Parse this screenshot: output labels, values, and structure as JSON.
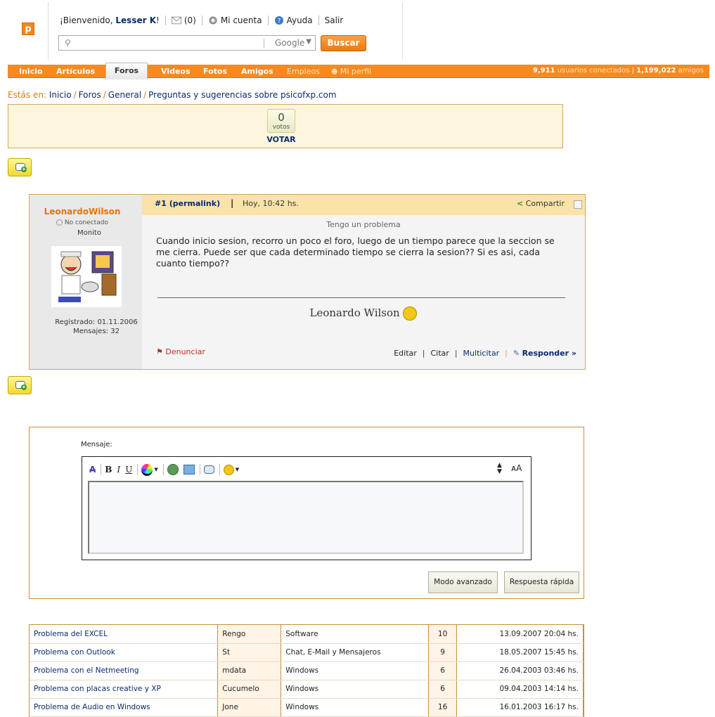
{
  "header": {
    "logo_letter": "p",
    "greeting": "¡Bienvenido,",
    "username": "Lesser K",
    "greeting_end": "!",
    "messages": "(0)",
    "account": "Mi cuenta",
    "help": "Ayuda",
    "logout": "Salir",
    "search_placeholder": "",
    "search_engine": "Google",
    "search_button": "Buscar"
  },
  "nav": {
    "items": [
      "Inicio",
      "Artículos",
      "Foros",
      "Videos",
      "Fotos",
      "Amigos",
      "Empleos",
      "Mi perfil"
    ],
    "users_online_count": "9,911",
    "users_online_label": "usuarios conectados",
    "friends_count": "1,199,022",
    "friends_label": "amigos"
  },
  "breadcrumb": {
    "prefix": "Estás en:",
    "items": [
      "Inicio",
      "Foros",
      "General",
      "Preguntas y sugerencias sobre psicofxp.com"
    ]
  },
  "vote": {
    "count": "0",
    "unit": "votos",
    "action": "VOTAR"
  },
  "post": {
    "author": "LeonardoWilson",
    "status": "No conectado",
    "rank": "Monito",
    "registered": "Registrado: 01.11.2006",
    "messages": "Mensajes: 32",
    "number": "#1",
    "permalink": "permalink",
    "date": "Hoy, 10:42 hs.",
    "share": "Compartir",
    "subject": "Tengo un problema",
    "text": "Cuando inicio sesion, recorro un poco el foro, luego de un tiempo parece que la seccion se me cierra. Puede ser que cada determinado tiempo se cierra la sesion?? Si es asi, cada cuanto tiempo??",
    "signature": "Leonardo Wilson",
    "report": "Denunciar",
    "edit": "Editar",
    "quote": "Citar",
    "multiquote": "Multicitar",
    "reply": "Responder »"
  },
  "reply_form": {
    "label": "Mensaje:",
    "advanced_button": "Modo avanzado",
    "quick_reply_button": "Respuesta rápida"
  },
  "related_threads": [
    {
      "title": "Problema del EXCEL",
      "author": "Rengo",
      "forum": "Software",
      "replies": "10",
      "date": "13.09.2007 20:04 hs."
    },
    {
      "title": "Problema con Outlook",
      "author": "St",
      "forum": "Chat, E-Mail y Mensajeros",
      "replies": "9",
      "date": "18.05.2007 15:45 hs."
    },
    {
      "title": "Problema con el Netmeeting",
      "author": "mdata",
      "forum": "Windows",
      "replies": "6",
      "date": "26.04.2003 03:46 hs."
    },
    {
      "title": "Problema con placas creative y XP",
      "author": "Cucumelo",
      "forum": "Windows",
      "replies": "6",
      "date": "09.04.2003 14:14 hs."
    },
    {
      "title": "Problema de Audio en Windows",
      "author": "Jone",
      "forum": "Windows",
      "replies": "16",
      "date": "16.01.2003 16:17 hs."
    }
  ],
  "colors": {
    "brand_orange": "#f68a1f",
    "link_blue": "#0a2a6b",
    "author_orange": "#e0760e"
  }
}
